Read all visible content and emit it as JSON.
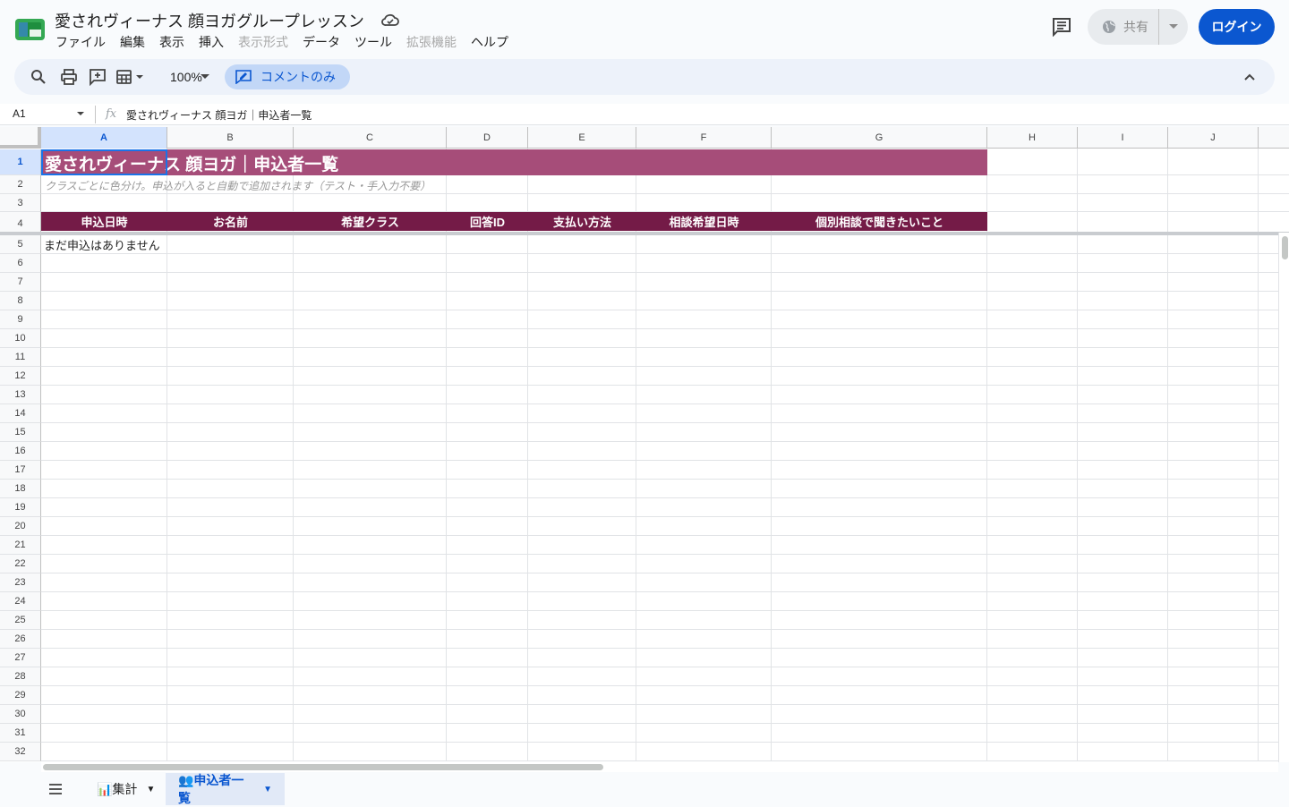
{
  "app": {
    "doc_title": "愛されヴィーナス 顔ヨガグループレッスン",
    "menu": [
      {
        "label": "ファイル",
        "disabled": false
      },
      {
        "label": "編集",
        "disabled": false
      },
      {
        "label": "表示",
        "disabled": false
      },
      {
        "label": "挿入",
        "disabled": false
      },
      {
        "label": "表示形式",
        "disabled": true
      },
      {
        "label": "データ",
        "disabled": false
      },
      {
        "label": "ツール",
        "disabled": false
      },
      {
        "label": "拡張機能",
        "disabled": true
      },
      {
        "label": "ヘルプ",
        "disabled": false
      }
    ],
    "share_label": "共有",
    "login_label": "ログイン",
    "brand_color": "#0b57d0"
  },
  "toolbar": {
    "zoom": "100%",
    "comment_only_label": "コメントのみ"
  },
  "formula": {
    "name_box": "A1",
    "fx_label": "fx",
    "content": "愛されヴィーナス 顔ヨガ｜申込者一覧"
  },
  "columns": [
    "A",
    "B",
    "C",
    "D",
    "E",
    "F",
    "G",
    "H",
    "I",
    "J"
  ],
  "rows": [
    "1",
    "2",
    "3",
    "4",
    "5",
    "6",
    "7",
    "8",
    "9",
    "10",
    "11",
    "12",
    "13",
    "14",
    "15",
    "16",
    "17",
    "18",
    "19",
    "20",
    "21",
    "22",
    "23",
    "24",
    "25",
    "26",
    "27",
    "28",
    "29",
    "30",
    "31",
    "32"
  ],
  "sheet": {
    "title": "愛されヴィーナス 顔ヨガ｜申込者一覧",
    "subtitle": "クラスごとに色分け。申込が入ると自動で追加されます（テスト・手入力不要）",
    "headers": [
      "申込日時",
      "お名前",
      "希望クラス",
      "回答ID",
      "支払い方法",
      "相談希望日時",
      "個別相談で聞きたいこと"
    ],
    "empty_message": "まだ申込はありません",
    "title_color": "#a64d79",
    "header_color": "#741b47"
  },
  "tabs": [
    {
      "label": "📊集計",
      "active": false
    },
    {
      "label": "👥申込者一覧",
      "active": true
    }
  ]
}
